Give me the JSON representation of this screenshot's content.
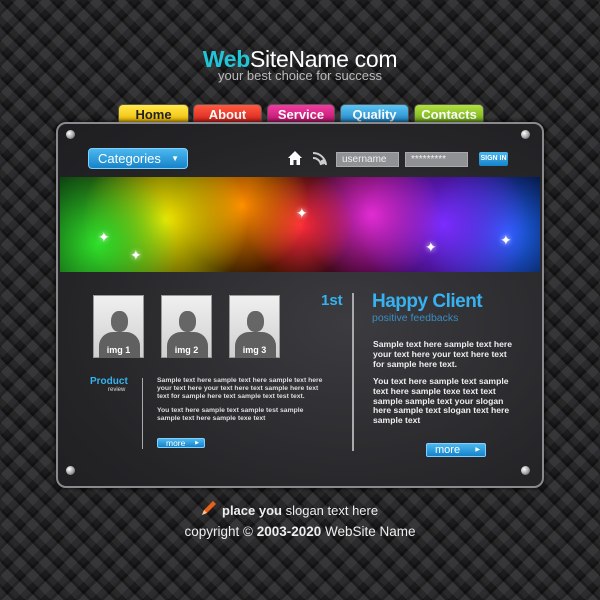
{
  "header": {
    "logo_bold": "Web",
    "logo_rest": "SiteName com",
    "tagline": "your best choice for success"
  },
  "nav": {
    "tabs": [
      {
        "label": "Home",
        "color": "#f5d400"
      },
      {
        "label": "About",
        "color": "#e8302a"
      },
      {
        "label": "Service",
        "color": "#d4187e"
      },
      {
        "label": "Quality",
        "color": "#2b9ad8"
      },
      {
        "label": "Contacts",
        "color": "#8cc020"
      }
    ]
  },
  "toolbar": {
    "categories_label": "Categories",
    "username_placeholder": "username",
    "password_value": "*********",
    "signin_label": "SIGN IN"
  },
  "gallery": {
    "images": [
      "img 1",
      "img 2",
      "img 3"
    ],
    "rank": "1st"
  },
  "product": {
    "title": "Product",
    "subtitle": "review",
    "para1": "Sample text here sample text here sample text here your text here your text here text sample here text text for sample here text sample text test text.",
    "para2": "You text here sample text sample test sample sample text here sample texe text",
    "more_label": "more"
  },
  "client": {
    "title": "Happy Client",
    "subtitle": "positive feedbacks",
    "para1": "Sample text here sample text here your text here your text here text for sample here text.",
    "para2": "You text here sample text sample text here sample texe text text sample sample text your slogan here sample text slogan text here sample text",
    "more_label": "more"
  },
  "footer": {
    "slogan_bold": "place you",
    "slogan_rest": "slogan text here",
    "copyright_prefix": "copyright © ",
    "copyright_years": "2003-2020",
    "copyright_name": " WebSite Name"
  }
}
